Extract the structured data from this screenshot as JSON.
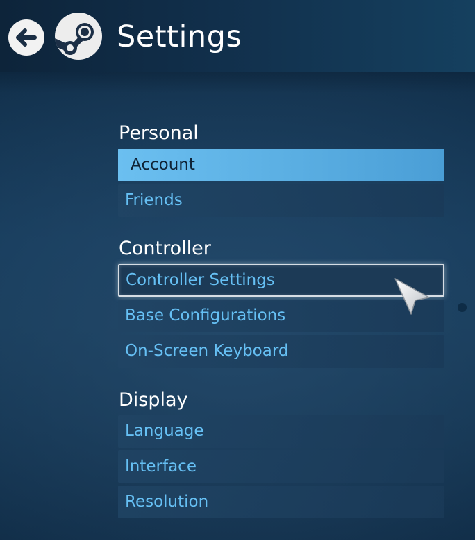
{
  "header": {
    "title": "Settings",
    "back_icon": "back-arrow-icon",
    "logo_icon": "steam-logo-icon"
  },
  "sections": [
    {
      "heading": "Personal",
      "items": [
        {
          "label": "Account",
          "state": "selected"
        },
        {
          "label": "Friends",
          "state": "normal"
        }
      ]
    },
    {
      "heading": "Controller",
      "items": [
        {
          "label": "Controller Settings",
          "state": "hover"
        },
        {
          "label": "Base Configurations",
          "state": "normal"
        },
        {
          "label": "On-Screen Keyboard",
          "state": "normal"
        }
      ]
    },
    {
      "heading": "Display",
      "items": [
        {
          "label": "Language",
          "state": "normal"
        },
        {
          "label": "Interface",
          "state": "normal"
        },
        {
          "label": "Resolution",
          "state": "normal"
        }
      ]
    }
  ],
  "colors": {
    "accent": "#66c0f4",
    "selected_bg": "#5aaee2",
    "selected_text": "#0f2336",
    "heading_text": "#ffffff"
  }
}
